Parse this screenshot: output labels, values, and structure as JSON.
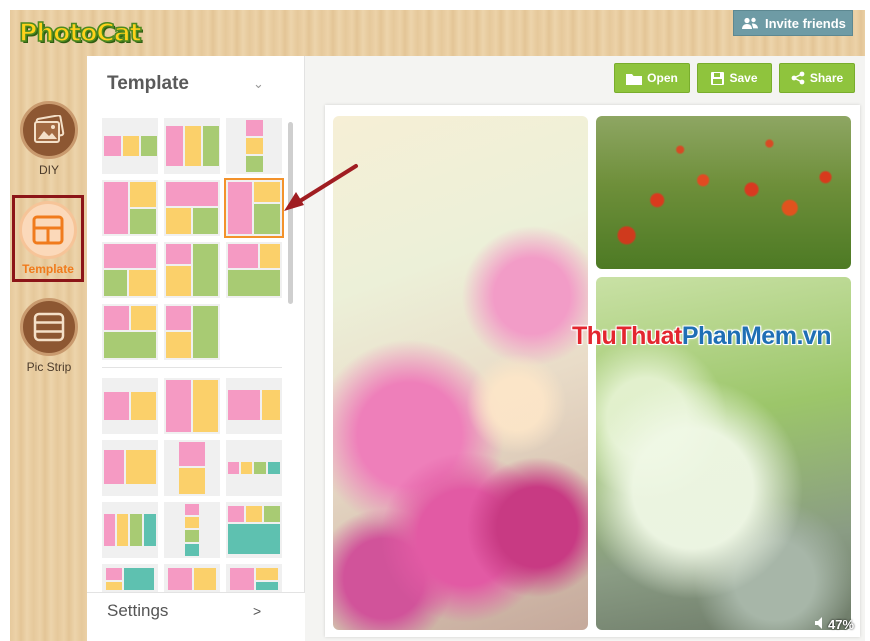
{
  "app": {
    "logo": "PhotoCat",
    "invite_label": "Invite friends"
  },
  "nav": [
    {
      "label": "DIY",
      "icon": "photo-frame-icon"
    },
    {
      "label": "Template",
      "icon": "template-layout-icon",
      "active": true
    },
    {
      "label": "Pic Strip",
      "icon": "pic-strip-icon"
    }
  ],
  "panel": {
    "title": "Template",
    "settings_label": "Settings",
    "settings_chevron": ">"
  },
  "toolbar": {
    "open_label": "Open",
    "save_label": "Save",
    "share_label": "Share"
  },
  "watermark": {
    "part1": "ThuThuat",
    "part2": "PhanMem.vn"
  },
  "zoom": {
    "value": "47%"
  },
  "colors": {
    "accent": "#8fc43d",
    "active_nav": "#f07b1c",
    "highlight_border": "#8c1518",
    "arrow": "#a01d22"
  }
}
